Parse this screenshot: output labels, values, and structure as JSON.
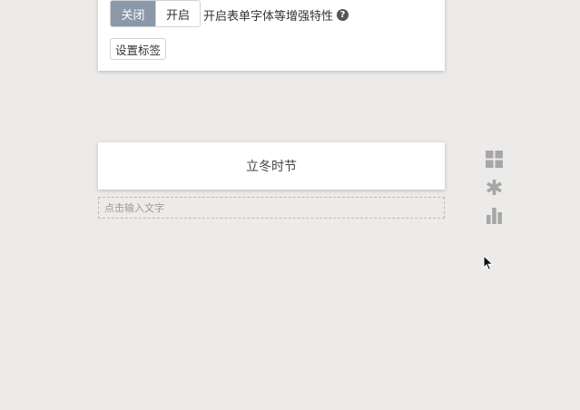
{
  "top_card": {
    "toggle_off_label": "关闭",
    "toggle_on_label": "开启",
    "enhance_text": "开启表单字体等增强特性",
    "help_glyph": "?",
    "set_tag_label": "设置标签"
  },
  "mid_card": {
    "title": "立冬时节"
  },
  "text_input": {
    "placeholder": "点击输入文字"
  },
  "side_tools": [
    {
      "icon": "grid-icon"
    },
    {
      "icon": "asterisk-icon"
    },
    {
      "icon": "bar-chart-icon"
    }
  ],
  "colors": {
    "background": "#edebe9",
    "toggle_active": "#8a98aa",
    "tool_icon": "#a6a6a6"
  }
}
